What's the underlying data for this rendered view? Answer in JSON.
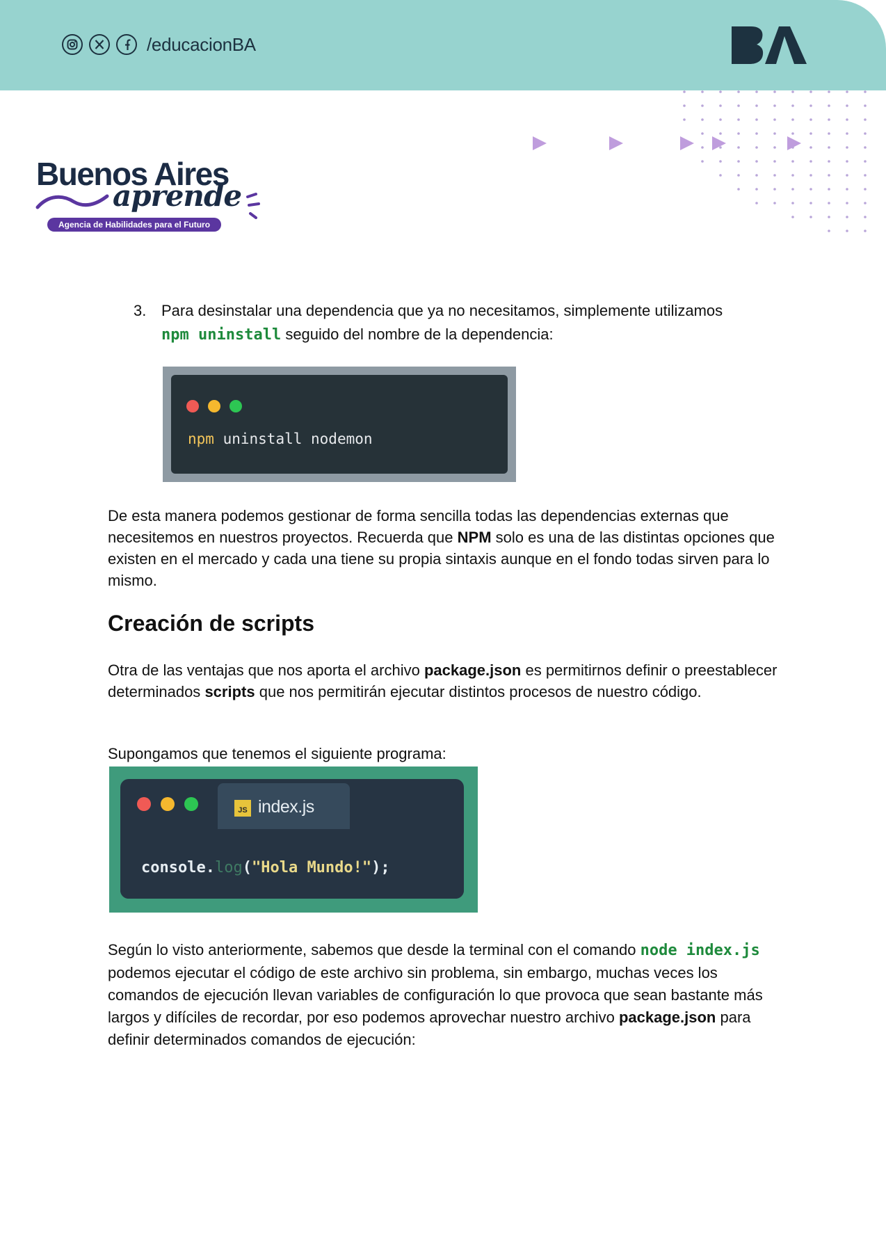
{
  "header": {
    "social_icons": [
      "instagram-icon",
      "x-icon",
      "facebook-icon"
    ],
    "handle": "/educacionBA",
    "logo_text": "BA",
    "colors": {
      "band": "#97d3cf",
      "logo": "#1d3240"
    }
  },
  "brand": {
    "title": "Buenos Aires",
    "script": "aprende",
    "badge": "Agencia de Habilidades para el Futuro",
    "colors": {
      "title": "#1b2b44",
      "accent": "#5b36a0"
    }
  },
  "item3": {
    "number": "3.",
    "text_before": "Para desinstalar una dependencia que ya no necesitamos, simplemente utilizamos",
    "code": "npm uninstall",
    "text_after": "seguido del nombre de la dependencia:"
  },
  "terminal": {
    "keyword": "npm",
    "rest": " uninstall nodemon",
    "dot_colors": [
      "#f05a55",
      "#f5b82e",
      "#2dc653"
    ]
  },
  "para1": {
    "text1": "De esta manera podemos gestionar de forma sencilla todas las dependencias externas que necesitemos en nuestros proyectos. Recuerda que",
    "bold": "NPM",
    "text2": "solo es una de las distintas opciones que existen en el mercado y cada una tiene su propia sintaxis aunque en el fondo todas sirven para lo mismo."
  },
  "section_heading": "Creación de scripts",
  "para2": {
    "t1": "Otra de las ventajas que nos aporta el archivo",
    "b1": "package.json",
    "t2": "es permitirnos definir o preestablecer determinados",
    "b2": "scripts",
    "t3": "que nos permitirán ejecutar distintos procesos de nuestro código."
  },
  "para3": "Supongamos que tenemos el siguiente programa:",
  "editor": {
    "tab_icon": "JS",
    "tab_label": "index.js",
    "code_obj": "console.",
    "code_fn": "log",
    "code_open": "(",
    "code_str": "\"Hola Mundo!\"",
    "code_close": ");",
    "dot_colors": [
      "#f05a55",
      "#f5b82e",
      "#2dc653"
    ]
  },
  "para4": {
    "t1": "Según lo visto anteriormente, sabemos que desde la terminal con el comando",
    "code": "node index.js",
    "t2": "podemos ejecutar el código de este archivo sin problema, sin embargo, muchas veces los comandos de ejecución llevan variables de configuración lo que provoca que sean bastante más largos y difíciles de recordar, por eso podemos aprovechar nuestro archivo",
    "b1": "package.json",
    "t3": "para definir determinados comandos de ejecución:"
  }
}
